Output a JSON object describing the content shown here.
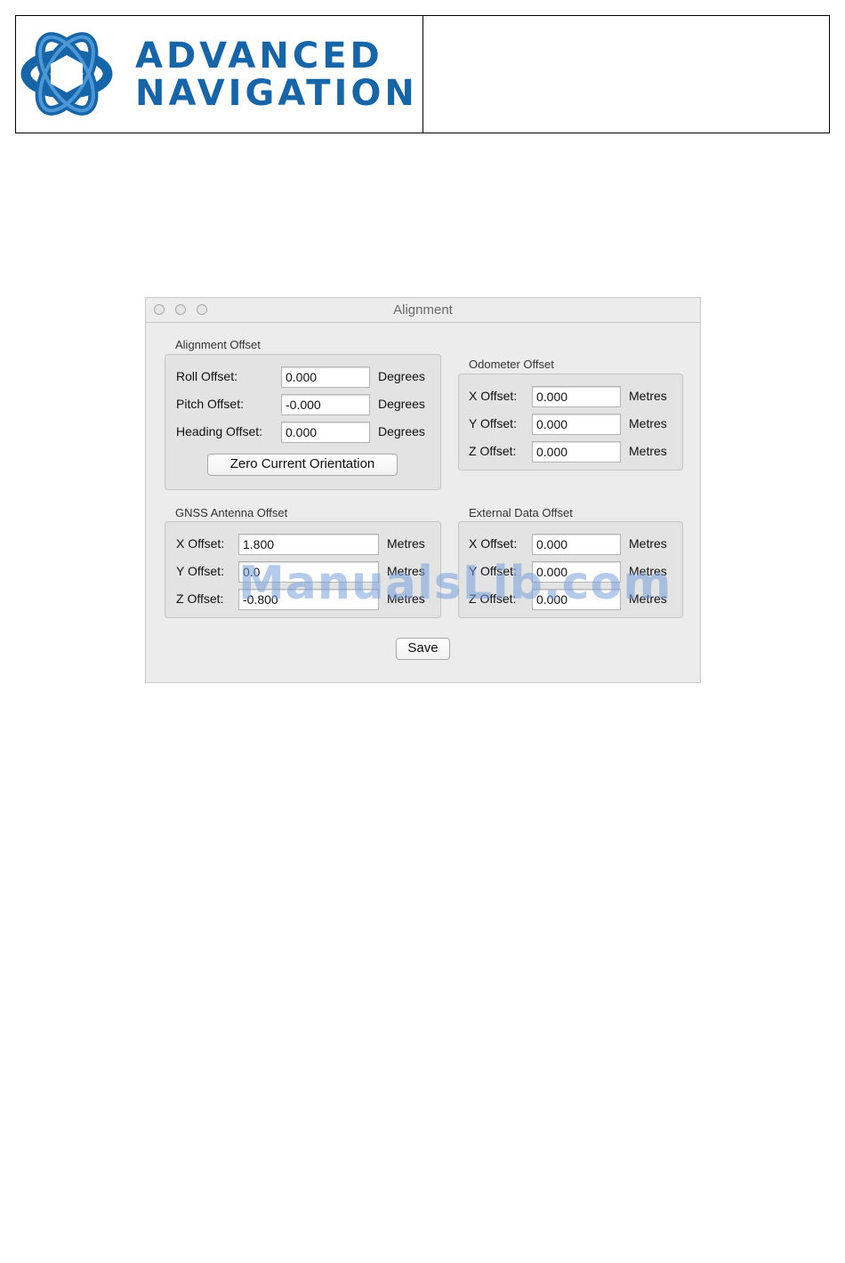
{
  "brand": {
    "line1": "ADVANCED",
    "line2": "NAVIGATION",
    "color": "#1565a8",
    "logo_icon": "advanced-navigation-logo-icon"
  },
  "window": {
    "title": "Alignment"
  },
  "alignment_offset": {
    "title": "Alignment Offset",
    "rows": [
      {
        "label": "Roll Offset:",
        "value": "0.000",
        "unit": "Degrees"
      },
      {
        "label": "Pitch Offset:",
        "value": "-0.000",
        "unit": "Degrees"
      },
      {
        "label": "Heading Offset:",
        "value": "0.000",
        "unit": "Degrees"
      }
    ],
    "zero_button": "Zero Current Orientation"
  },
  "odometer_offset": {
    "title": "Odometer Offset",
    "rows": [
      {
        "label": "X Offset:",
        "value": "0.000",
        "unit": "Metres"
      },
      {
        "label": "Y Offset:",
        "value": "0.000",
        "unit": "Metres"
      },
      {
        "label": "Z Offset:",
        "value": "0.000",
        "unit": "Metres"
      }
    ]
  },
  "gnss_antenna_offset": {
    "title": "GNSS Antenna Offset",
    "rows": [
      {
        "label": "X Offset:",
        "value": "1.800",
        "unit": "Metres"
      },
      {
        "label": "Y Offset:",
        "value": "0.0",
        "unit": "Metres"
      },
      {
        "label": "Z Offset:",
        "value": "-0.800",
        "unit": "Metres"
      }
    ]
  },
  "external_data_offset": {
    "title": "External Data Offset",
    "rows": [
      {
        "label": "X Offset:",
        "value": "0.000",
        "unit": "Metres"
      },
      {
        "label": "Y Offset:",
        "value": "0.000",
        "unit": "Metres"
      },
      {
        "label": "Z Offset:",
        "value": "0.000",
        "unit": "Metres"
      }
    ]
  },
  "save_button": "Save",
  "watermark": "ManualsLib.com"
}
